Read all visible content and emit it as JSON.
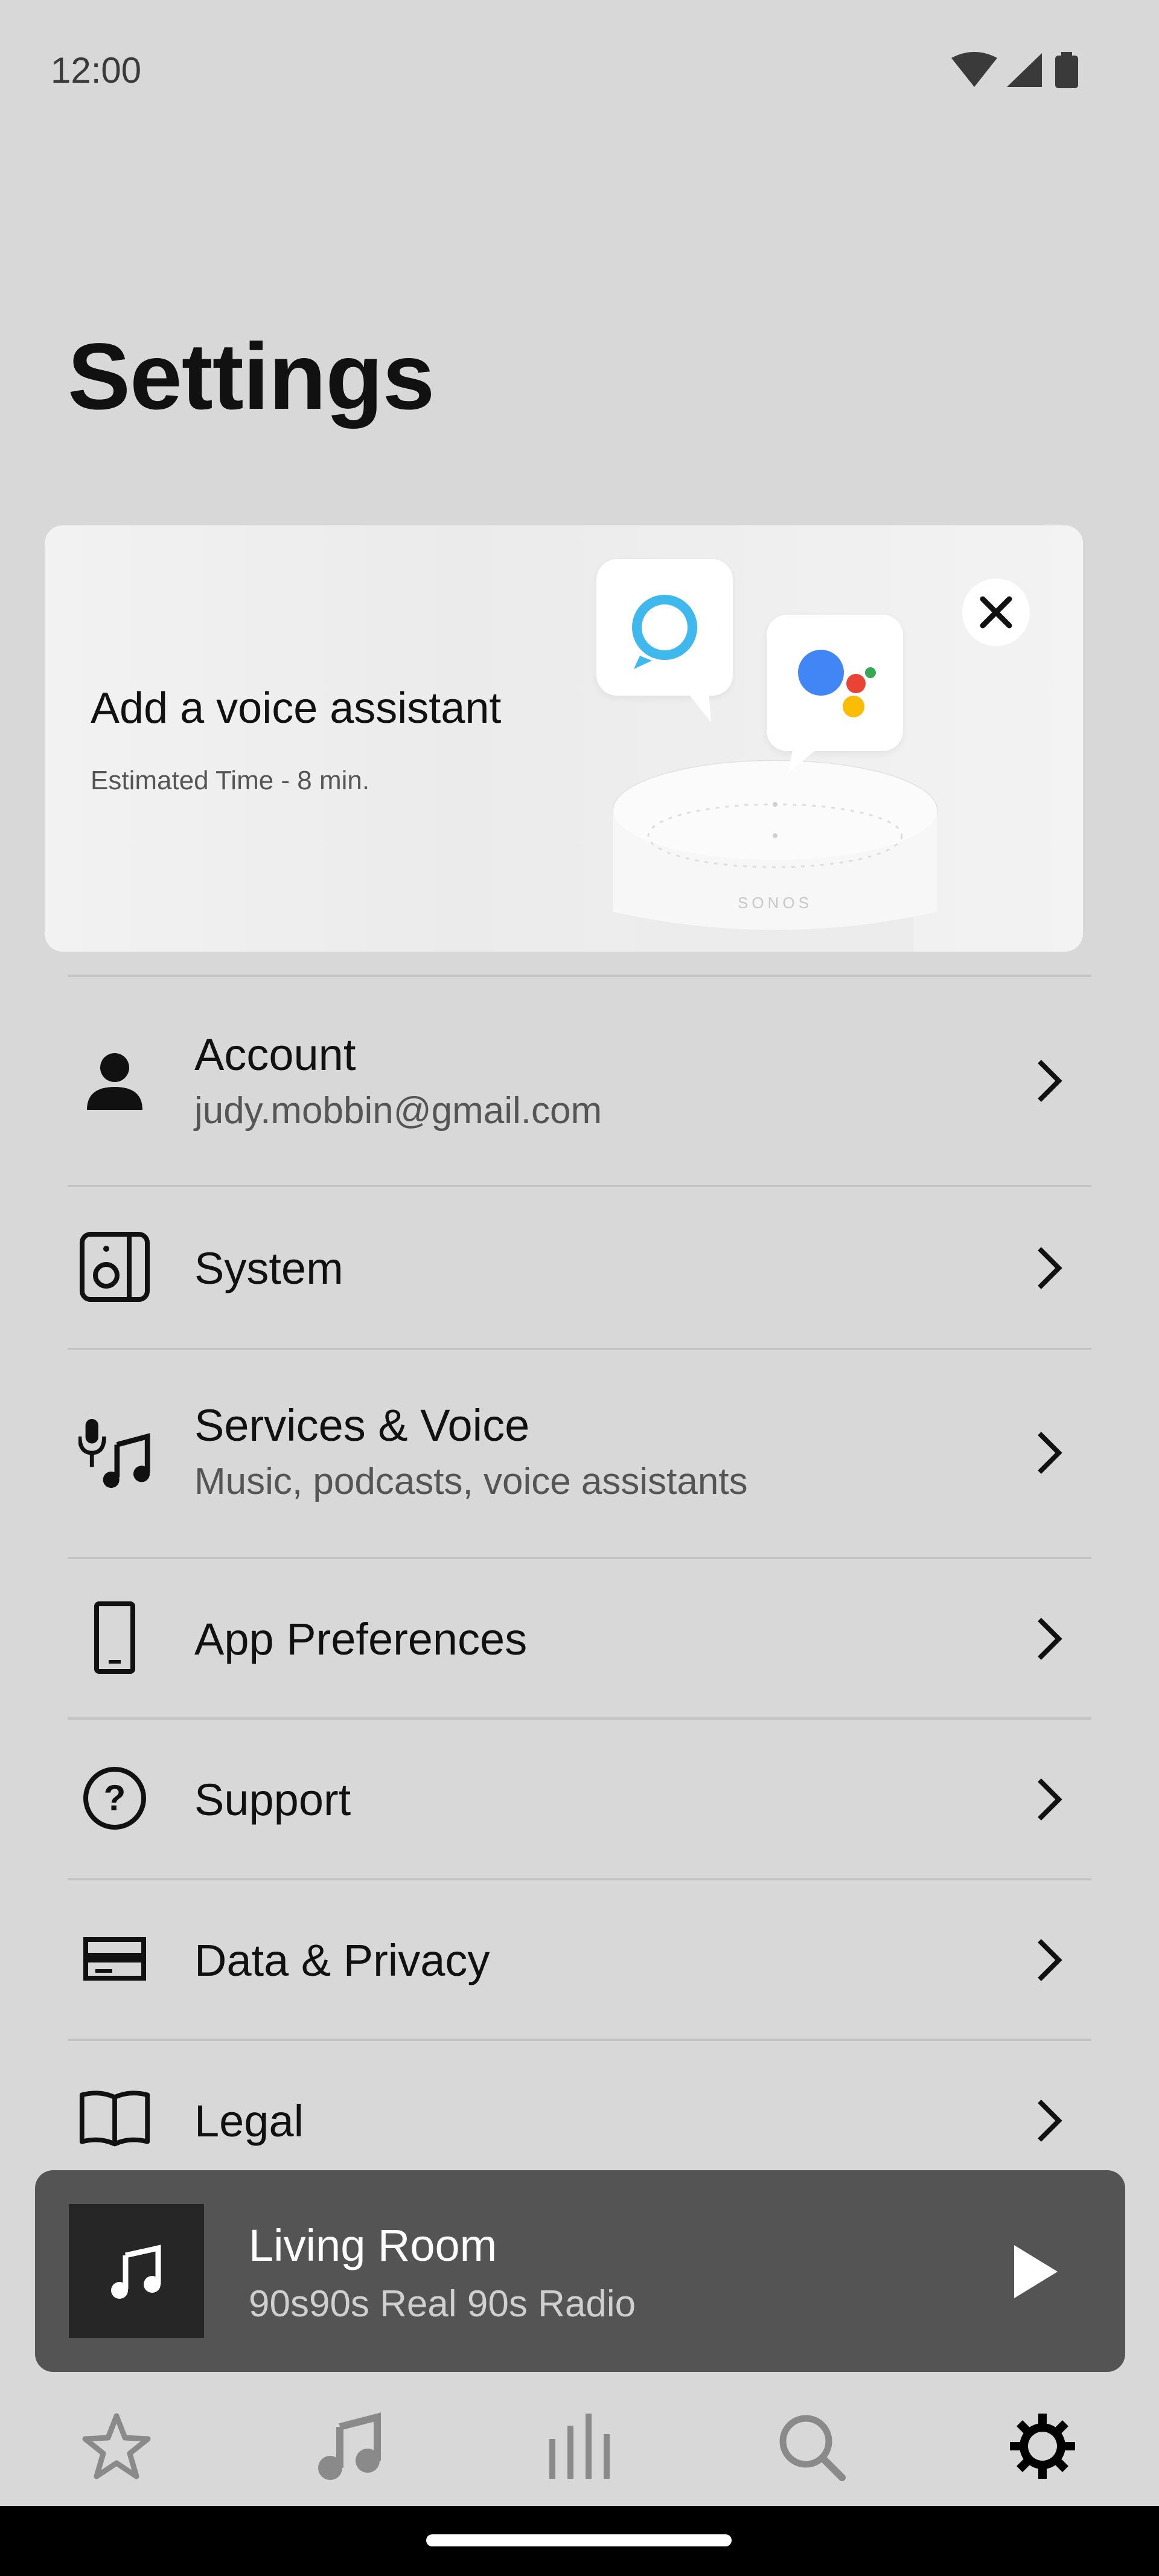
{
  "status_bar": {
    "time": "12:00",
    "icons": [
      "wifi-icon",
      "signal-icon",
      "battery-icon"
    ]
  },
  "page": {
    "title": "Settings"
  },
  "voice_banner": {
    "title": "Add a voice assistant",
    "subtitle": "Estimated Time - 8 min.",
    "speaker_brand": "SONOS",
    "close_icon": "close-icon"
  },
  "settings_items": [
    {
      "label": "Account",
      "sublabel": "judy.mobbin@gmail.com",
      "icon": "person-icon"
    },
    {
      "label": "System",
      "icon": "speaker-icon"
    },
    {
      "label": "Services & Voice",
      "sublabel": "Music, podcasts, voice assistants",
      "icon": "mic-music-icon"
    },
    {
      "label": "App Preferences",
      "icon": "phone-icon"
    },
    {
      "label": "Support",
      "icon": "help-icon"
    },
    {
      "label": "Data & Privacy",
      "icon": "data-privacy-icon"
    },
    {
      "label": "Legal",
      "icon": "book-icon"
    }
  ],
  "now_playing": {
    "room": "Living Room",
    "station": "90s90s Real 90s Radio",
    "action_icon": "play-icon"
  },
  "tab_bar": {
    "tabs": [
      {
        "name": "favorites",
        "icon": "star-icon",
        "active": false
      },
      {
        "name": "browse",
        "icon": "music-note-icon",
        "active": false
      },
      {
        "name": "system-view",
        "icon": "equalizer-icon",
        "active": false
      },
      {
        "name": "search",
        "icon": "search-icon",
        "active": false
      },
      {
        "name": "settings",
        "icon": "gear-icon",
        "active": true
      }
    ]
  },
  "colors": {
    "background": "#d8d8d8",
    "banner": "#f0f0f0",
    "now_playing": "#545454",
    "tab_inactive": "#8a8a8a",
    "tab_active": "#000000",
    "alexa_blue": "#3fb8ee",
    "google_blue": "#4285f4",
    "google_red": "#ea4335",
    "google_yellow": "#fbbc05",
    "google_green": "#34a853"
  }
}
